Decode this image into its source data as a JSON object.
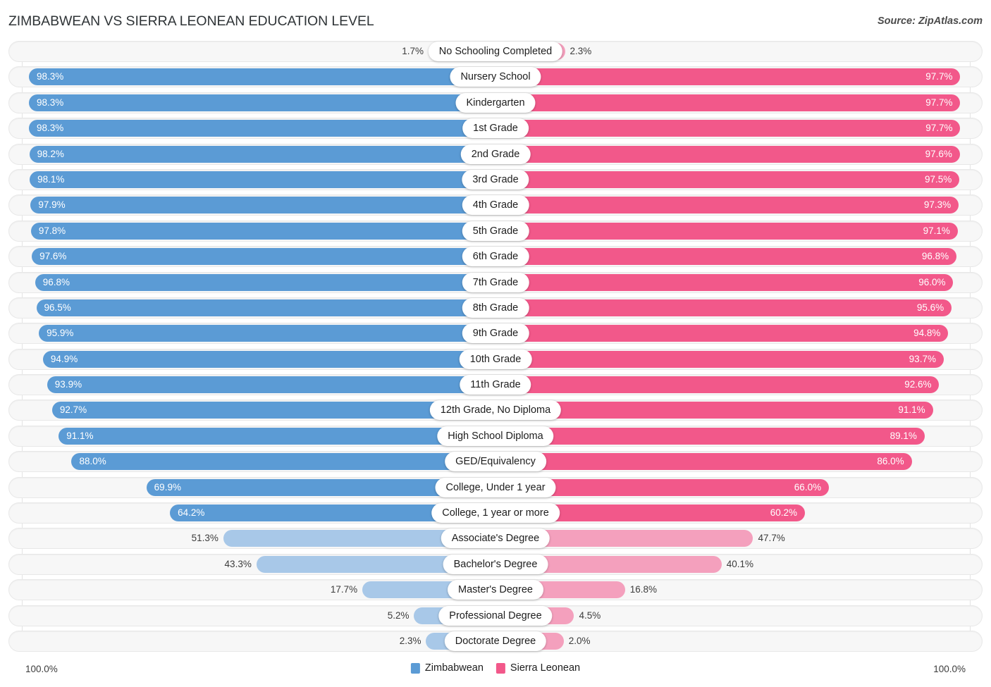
{
  "header": {
    "title": "ZIMBABWEAN VS SIERRA LEONEAN EDUCATION LEVEL",
    "source": "Source: ZipAtlas.com"
  },
  "footer": {
    "axis_min": "100.0%",
    "axis_max": "100.0%",
    "legend": [
      {
        "label": "Zimbabwean",
        "color": "#5b9bd5"
      },
      {
        "label": "Sierra Leonean",
        "color": "#f2588a"
      }
    ]
  },
  "colors": {
    "left_strong": "#5b9bd5",
    "left_light": "#a8c8e8",
    "right_strong": "#f2588a",
    "right_light": "#f4a0bd",
    "track": "#f7f7f7",
    "track_border": "#e8e8e8",
    "gridline": "#e3e3e3"
  },
  "chart_data": {
    "type": "bar",
    "title": "ZIMBABWEAN VS SIERRA LEONEAN EDUCATION LEVEL",
    "subtitle": "",
    "xlabel": "",
    "ylabel": "",
    "orientation": "horizontal-diverging",
    "grid": true,
    "legend_position": "bottom-center",
    "xlim": [
      0,
      100
    ],
    "axis_labels": {
      "left": "100.0%",
      "right": "100.0%"
    },
    "series": [
      {
        "name": "Zimbabwean",
        "color": "#5b9bd5",
        "side": "left"
      },
      {
        "name": "Sierra Leonean",
        "color": "#f2588a",
        "side": "right"
      }
    ],
    "categories": [
      "No Schooling Completed",
      "Nursery School",
      "Kindergarten",
      "1st Grade",
      "2nd Grade",
      "3rd Grade",
      "4th Grade",
      "5th Grade",
      "6th Grade",
      "7th Grade",
      "8th Grade",
      "9th Grade",
      "10th Grade",
      "11th Grade",
      "12th Grade, No Diploma",
      "High School Diploma",
      "GED/Equivalency",
      "College, Under 1 year",
      "College, 1 year or more",
      "Associate's Degree",
      "Bachelor's Degree",
      "Master's Degree",
      "Professional Degree",
      "Doctorate Degree"
    ],
    "values_left": [
      1.7,
      98.3,
      98.3,
      98.3,
      98.2,
      98.1,
      97.9,
      97.8,
      97.6,
      96.8,
      96.5,
      95.9,
      94.9,
      93.9,
      92.7,
      91.1,
      88.0,
      69.9,
      64.2,
      51.3,
      43.3,
      17.7,
      5.2,
      2.3
    ],
    "values_right": [
      2.3,
      97.7,
      97.7,
      97.7,
      97.6,
      97.5,
      97.3,
      97.1,
      96.8,
      96.0,
      95.6,
      94.8,
      93.7,
      92.6,
      91.1,
      89.1,
      86.0,
      66.0,
      60.2,
      47.7,
      40.1,
      16.8,
      4.5,
      2.0
    ],
    "labels_left": [
      "1.7%",
      "98.3%",
      "98.3%",
      "98.3%",
      "98.2%",
      "98.1%",
      "97.9%",
      "97.8%",
      "97.6%",
      "96.8%",
      "96.5%",
      "95.9%",
      "94.9%",
      "93.9%",
      "92.7%",
      "91.1%",
      "88.0%",
      "69.9%",
      "64.2%",
      "51.3%",
      "43.3%",
      "17.7%",
      "5.2%",
      "2.3%"
    ],
    "labels_right": [
      "2.3%",
      "97.7%",
      "97.7%",
      "97.7%",
      "97.6%",
      "97.5%",
      "97.3%",
      "97.1%",
      "96.8%",
      "96.0%",
      "95.6%",
      "94.8%",
      "93.7%",
      "92.6%",
      "91.1%",
      "89.1%",
      "86.0%",
      "66.0%",
      "60.2%",
      "47.7%",
      "40.1%",
      "16.8%",
      "4.5%",
      "2.0%"
    ]
  }
}
